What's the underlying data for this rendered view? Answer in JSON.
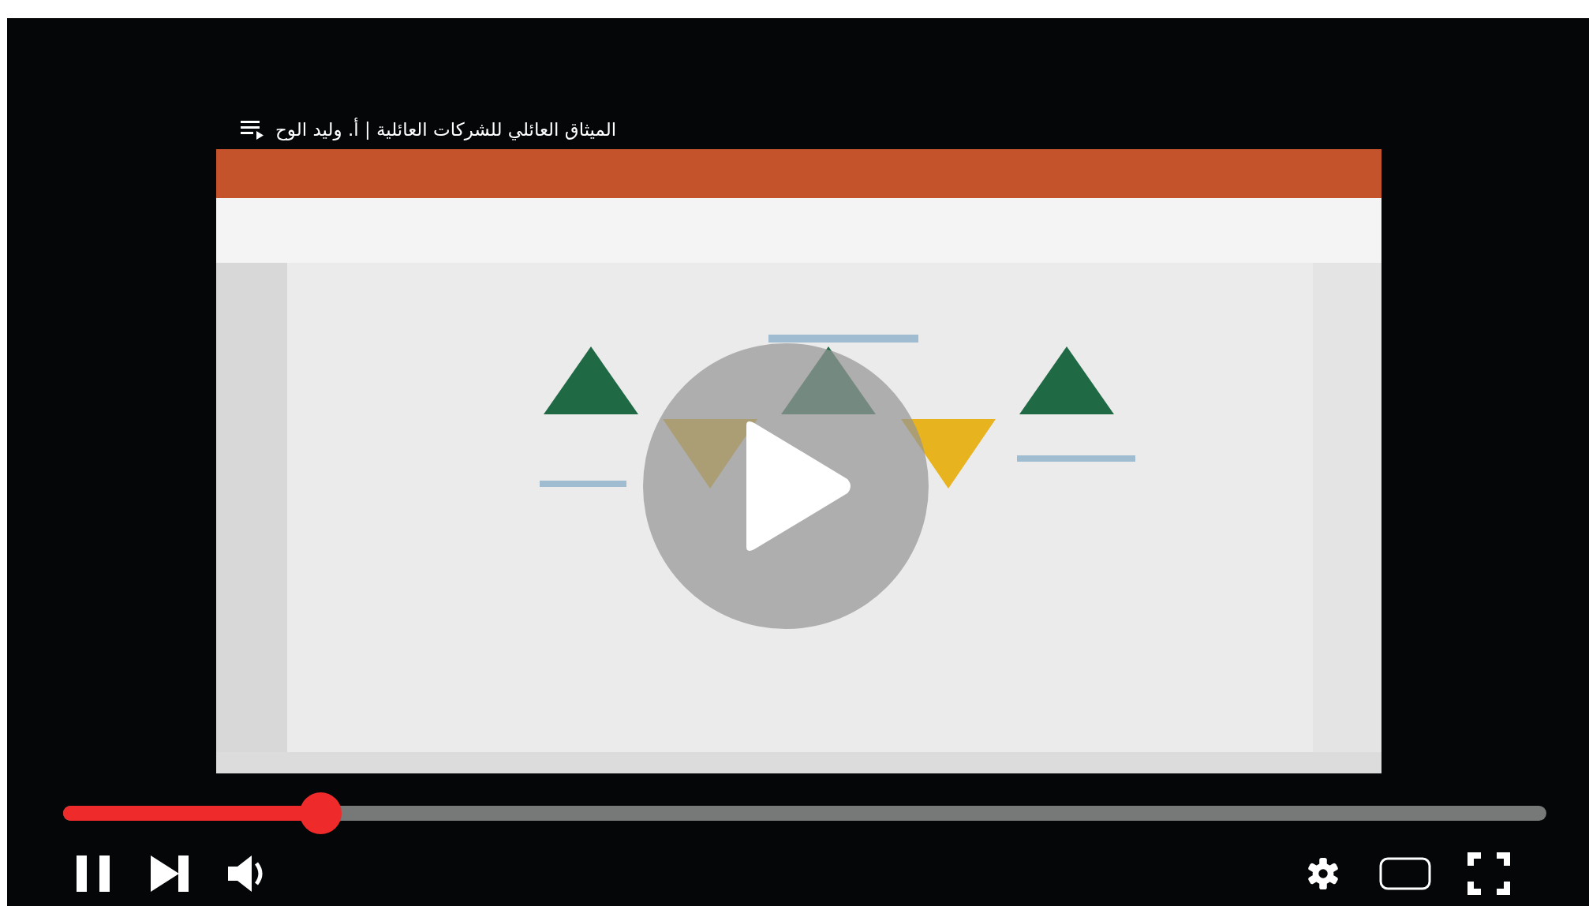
{
  "video": {
    "title": "الميثاق العائلي للشركات العائلية | أ. وليد الوح",
    "kind": "picture"
  },
  "player": {
    "playing": true,
    "progress": {
      "level": 0.174
    }
  }
}
